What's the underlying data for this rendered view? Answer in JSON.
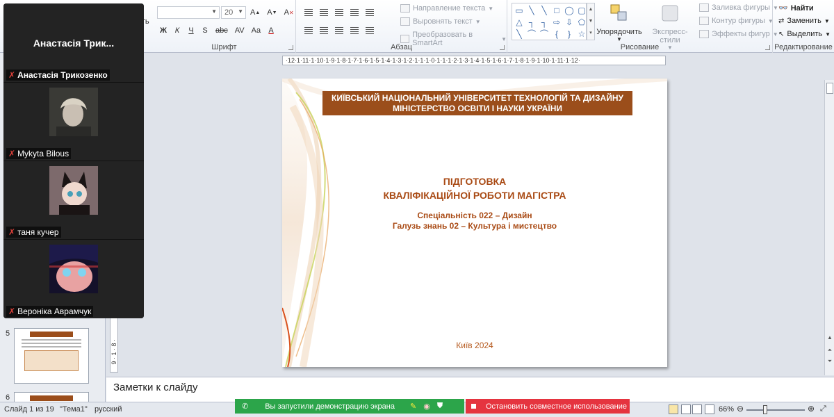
{
  "ribbon": {
    "font_size": "20",
    "font_group_label": "Шрифт",
    "paragraph_group_label": "Абзац",
    "drawing_group_label": "Рисование",
    "editing_group_label": "Редактирование",
    "text_direction": "Направление текста",
    "align_text": "Выровнять текст",
    "convert_smartart": "Преобразовать в SmartArt",
    "arrange": "Упорядочить",
    "quick_styles": "Экспресс-стили",
    "shape_fill": "Заливка фигуры",
    "shape_outline": "Контур фигуры",
    "shape_effects": "Эффекты фигур",
    "find": "Найти",
    "replace": "Заменить",
    "select": "Выделить",
    "partial_label": "ать"
  },
  "zoom": {
    "host_title": "Анастасія Трик...",
    "participants": [
      {
        "name": "Анастасія Трикозенко"
      },
      {
        "name": "Mykyta Bilous"
      },
      {
        "name": "таня кучер"
      },
      {
        "name": "Вероніка Аврамчук"
      }
    ]
  },
  "thumbnails": [
    {
      "number": "5"
    },
    {
      "number": "6"
    }
  ],
  "ruler": {
    "horizontal": "·12·1·11·1·10·1·9·1·8·1·7·1·6·1·5·1·4·1·3·1·2·1·1·1·0·1·1·1·2·1·3·1·4·1·5·1·6·1·7·1·8·1·9·1·10·1·11·1·12·",
    "vertical": "9 · 1 · 8 ·"
  },
  "slide": {
    "university": "КИЇВСЬКИЙ НАЦІОНАЛЬНИЙ УНІВЕРСИТЕТ ТЕХНОЛОГІЙ ТА ДИЗАЙНУ",
    "ministry": "МІНІСТЕРСТВО ОСВІТИ І НАУКИ УКРАЇНИ",
    "title_line1": "ПІДГОТОВКА",
    "title_line2": "КВАЛІФІКАЦІЙНОЇ РОБОТИ МАГІСТРА",
    "specialty": "Спеціальність 022 – Дизайн",
    "field": "Галузь знань  02 – Культура і мистецтво",
    "city_year": "Київ 2024",
    "banner_color": "#9b4e1b",
    "title_color": "#a94a14"
  },
  "notes": {
    "placeholder": "Заметки к слайду"
  },
  "status": {
    "slide_info": "Слайд 1 из 19",
    "theme": "\"Тема1\"",
    "language": "русский",
    "zoom": "66%"
  },
  "screen_share": {
    "message": "Вы запустили демонстрацию экрана",
    "stop": "Остановить совместное использование",
    "green": "#2ca54a",
    "red": "#e5343f"
  }
}
